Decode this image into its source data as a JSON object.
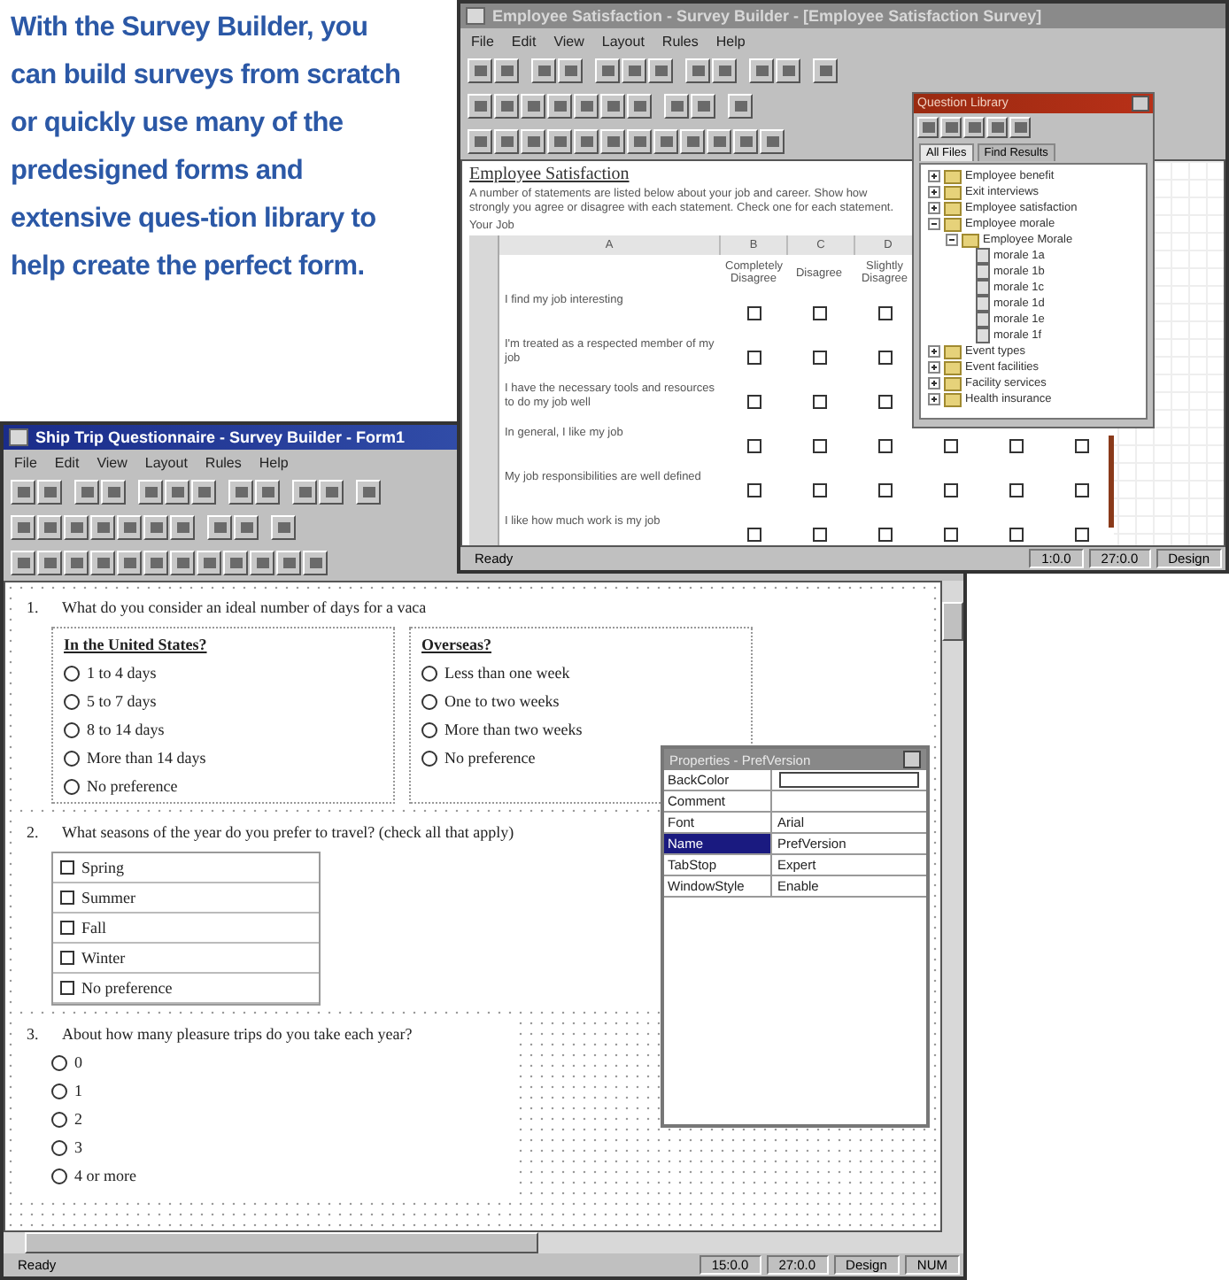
{
  "caption": "With the Survey Builder, you can build surveys from scratch or quickly use many of the predesigned forms and extensive ques-tion library to help create the perfect form.",
  "form_window": {
    "title": "Ship Trip Questionnaire - Survey Builder - Form1",
    "menu": [
      "File",
      "Edit",
      "View",
      "Layout",
      "Rules",
      "Help"
    ],
    "questions": [
      {
        "kind": "radio_groups",
        "number": "1.",
        "text": "What do you consider an ideal number of days for a vaca",
        "groups": [
          {
            "heading": "In the United States?",
            "options": [
              {
                "label": "1 to 4 days",
                "selected": false
              },
              {
                "label": "5 to 7 days",
                "selected": false
              },
              {
                "label": "8 to 14 days",
                "selected": false
              },
              {
                "label": "More than 14 days",
                "selected": false
              },
              {
                "label": "No preference",
                "selected": false
              }
            ]
          },
          {
            "heading": "Overseas?",
            "options": [
              {
                "label": "Less than one week",
                "selected": false
              },
              {
                "label": "One to two weeks",
                "selected": false
              },
              {
                "label": "More than two weeks",
                "selected": false
              },
              {
                "label": "No preference",
                "selected": false
              }
            ]
          }
        ]
      },
      {
        "kind": "checkbox_list",
        "number": "2.",
        "text": "What seasons of the year do you prefer to travel?  (check all that apply)",
        "options": [
          {
            "label": "Spring",
            "checked": false
          },
          {
            "label": "Summer",
            "checked": false
          },
          {
            "label": "Fall",
            "checked": false
          },
          {
            "label": "Winter",
            "checked": false
          },
          {
            "label": "No preference",
            "checked": false
          }
        ]
      },
      {
        "kind": "radio_list",
        "number": "3.",
        "text": "About how many pleasure trips do you take each year?",
        "options": [
          {
            "label": "0",
            "selected": false
          },
          {
            "label": "1",
            "selected": false
          },
          {
            "label": "2",
            "selected": false
          },
          {
            "label": "3",
            "selected": false
          },
          {
            "label": "4 or more",
            "selected": false
          }
        ]
      }
    ],
    "properties": {
      "title": "Properties - PrefVersion",
      "rows": [
        {
          "kind": "field",
          "name": "BackColor",
          "selected": false
        },
        {
          "kind": "text",
          "name": "Comment",
          "selected": false
        },
        {
          "kind": "text",
          "name": "Font",
          "value": "Arial",
          "selected": false
        },
        {
          "kind": "text",
          "name": "Name",
          "value": "PrefVersion",
          "selected": true
        },
        {
          "kind": "text",
          "name": "TabStop",
          "value": "Expert",
          "selected": false
        },
        {
          "kind": "text",
          "name": "WindowStyle",
          "value": "Enable",
          "selected": false
        }
      ]
    },
    "status_bar": [
      "Ready",
      "15:0.0",
      "27:0.0",
      "Design",
      "NUM"
    ]
  },
  "library_window": {
    "title": "Employee Satisfaction - Survey Builder - [Employee Satisfaction Survey]",
    "menu": [
      "File",
      "Edit",
      "View",
      "Layout",
      "Rules",
      "Help"
    ],
    "heading": "Employee Satisfaction",
    "intro": "A number of statements are listed below about your job and career.  Show how strongly you agree or disagree with each statement.  Check one for each statement.",
    "section": "Your Job",
    "columns": [
      {
        "letter": "A"
      },
      {
        "letter": "B",
        "label": "Completely Disagree"
      },
      {
        "letter": "C",
        "label": "Disagree"
      },
      {
        "letter": "D",
        "label": "Slightly Disagree"
      }
    ],
    "rows": [
      {
        "statement": "I find my job interesting",
        "answers": [
          false,
          false,
          false
        ]
      },
      {
        "statement": "I'm treated as a respected member of my job",
        "answers": [
          false,
          false,
          false
        ]
      },
      {
        "statement": "I have the necessary tools and resources to do my job well",
        "answers": [
          false,
          false,
          false
        ]
      },
      {
        "statement": "In general, I like my job",
        "answers": [
          false,
          false,
          false,
          false,
          false,
          false
        ]
      },
      {
        "statement": "My job responsibilities are well defined",
        "answers": [
          false,
          false,
          false,
          false,
          false,
          false
        ]
      },
      {
        "statement": "I like how much work is my job",
        "answers": [
          false,
          false,
          false,
          false,
          false,
          false
        ]
      }
    ],
    "library": {
      "title": "Question Library",
      "tabs": [
        {
          "label": "All Files",
          "selected": true
        },
        {
          "label": "Find Results",
          "selected": false
        }
      ],
      "tree": [
        {
          "label": "Employee benefit",
          "expanded": false
        },
        {
          "label": "Exit interviews",
          "expanded": false
        },
        {
          "label": "Employee satisfaction",
          "expanded": false
        },
        {
          "label": "Employee morale",
          "expanded": true,
          "children": [
            {
              "label": "Employee Morale",
              "expanded": true,
              "children": [
                {
                  "label": "morale 1a"
                },
                {
                  "label": "morale 1b"
                },
                {
                  "label": "morale 1c"
                },
                {
                  "label": "morale 1d"
                },
                {
                  "label": "morale 1e"
                },
                {
                  "label": "morale 1f"
                }
              ]
            }
          ]
        },
        {
          "label": "Event types",
          "expanded": false
        },
        {
          "label": "Event facilities",
          "expanded": false
        },
        {
          "label": "Facility services",
          "expanded": false
        },
        {
          "label": "Health insurance",
          "expanded": false
        }
      ]
    },
    "status_bar": [
      "Ready",
      "1:0.0",
      "27:0.0",
      "Design"
    ]
  }
}
